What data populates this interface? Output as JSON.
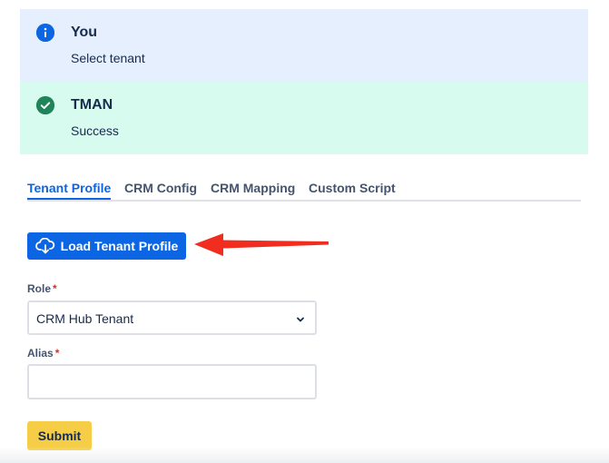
{
  "flags": {
    "info": {
      "icon": "info-icon",
      "title": "You",
      "body": "Select tenant"
    },
    "success": {
      "icon": "check-circle-icon",
      "title": "TMAN",
      "body": "Success"
    }
  },
  "tabs": [
    {
      "label": "Tenant Profile",
      "active": true
    },
    {
      "label": "CRM Config",
      "active": false
    },
    {
      "label": "CRM Mapping",
      "active": false
    },
    {
      "label": "Custom Script",
      "active": false
    }
  ],
  "load_button": {
    "icon": "cloud-download-icon",
    "label": "Load Tenant Profile"
  },
  "form": {
    "role": {
      "label": "Role",
      "required_mark": "*",
      "value": "CRM Hub Tenant"
    },
    "alias": {
      "label": "Alias",
      "required_mark": "*",
      "value": ""
    },
    "submit_label": "Submit"
  },
  "colors": {
    "primary": "#0c66e4",
    "info_bg": "#e6effd",
    "success_bg": "#d7fbef",
    "success_icon": "#1f845a",
    "submit": "#f5cd47",
    "annotation_arrow": "#f02d1e",
    "required": "#c9372c"
  }
}
